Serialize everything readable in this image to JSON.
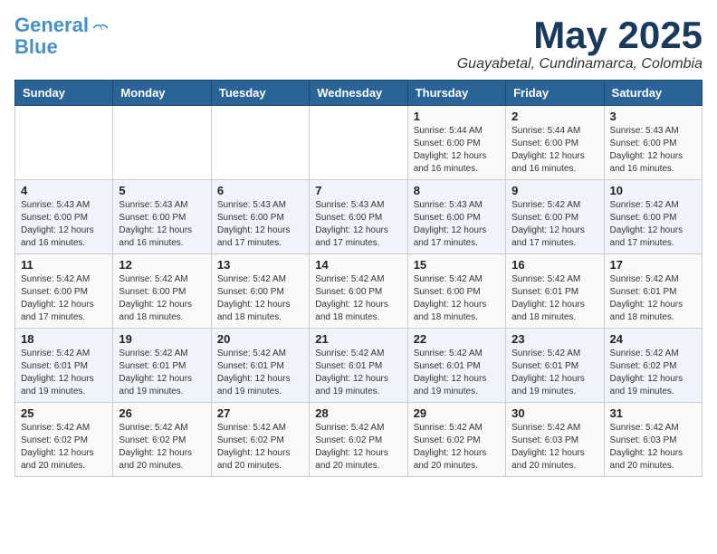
{
  "logo": {
    "line1": "General",
    "line2": "Blue"
  },
  "title": "May 2025",
  "location": "Guayabetal, Cundinamarca, Colombia",
  "weekdays": [
    "Sunday",
    "Monday",
    "Tuesday",
    "Wednesday",
    "Thursday",
    "Friday",
    "Saturday"
  ],
  "weeks": [
    [
      {
        "day": "",
        "info": ""
      },
      {
        "day": "",
        "info": ""
      },
      {
        "day": "",
        "info": ""
      },
      {
        "day": "",
        "info": ""
      },
      {
        "day": "1",
        "info": "Sunrise: 5:44 AM\nSunset: 6:00 PM\nDaylight: 12 hours\nand 16 minutes."
      },
      {
        "day": "2",
        "info": "Sunrise: 5:44 AM\nSunset: 6:00 PM\nDaylight: 12 hours\nand 16 minutes."
      },
      {
        "day": "3",
        "info": "Sunrise: 5:43 AM\nSunset: 6:00 PM\nDaylight: 12 hours\nand 16 minutes."
      }
    ],
    [
      {
        "day": "4",
        "info": "Sunrise: 5:43 AM\nSunset: 6:00 PM\nDaylight: 12 hours\nand 16 minutes."
      },
      {
        "day": "5",
        "info": "Sunrise: 5:43 AM\nSunset: 6:00 PM\nDaylight: 12 hours\nand 16 minutes."
      },
      {
        "day": "6",
        "info": "Sunrise: 5:43 AM\nSunset: 6:00 PM\nDaylight: 12 hours\nand 17 minutes."
      },
      {
        "day": "7",
        "info": "Sunrise: 5:43 AM\nSunset: 6:00 PM\nDaylight: 12 hours\nand 17 minutes."
      },
      {
        "day": "8",
        "info": "Sunrise: 5:43 AM\nSunset: 6:00 PM\nDaylight: 12 hours\nand 17 minutes."
      },
      {
        "day": "9",
        "info": "Sunrise: 5:42 AM\nSunset: 6:00 PM\nDaylight: 12 hours\nand 17 minutes."
      },
      {
        "day": "10",
        "info": "Sunrise: 5:42 AM\nSunset: 6:00 PM\nDaylight: 12 hours\nand 17 minutes."
      }
    ],
    [
      {
        "day": "11",
        "info": "Sunrise: 5:42 AM\nSunset: 6:00 PM\nDaylight: 12 hours\nand 17 minutes."
      },
      {
        "day": "12",
        "info": "Sunrise: 5:42 AM\nSunset: 6:00 PM\nDaylight: 12 hours\nand 18 minutes."
      },
      {
        "day": "13",
        "info": "Sunrise: 5:42 AM\nSunset: 6:00 PM\nDaylight: 12 hours\nand 18 minutes."
      },
      {
        "day": "14",
        "info": "Sunrise: 5:42 AM\nSunset: 6:00 PM\nDaylight: 12 hours\nand 18 minutes."
      },
      {
        "day": "15",
        "info": "Sunrise: 5:42 AM\nSunset: 6:00 PM\nDaylight: 12 hours\nand 18 minutes."
      },
      {
        "day": "16",
        "info": "Sunrise: 5:42 AM\nSunset: 6:01 PM\nDaylight: 12 hours\nand 18 minutes."
      },
      {
        "day": "17",
        "info": "Sunrise: 5:42 AM\nSunset: 6:01 PM\nDaylight: 12 hours\nand 18 minutes."
      }
    ],
    [
      {
        "day": "18",
        "info": "Sunrise: 5:42 AM\nSunset: 6:01 PM\nDaylight: 12 hours\nand 19 minutes."
      },
      {
        "day": "19",
        "info": "Sunrise: 5:42 AM\nSunset: 6:01 PM\nDaylight: 12 hours\nand 19 minutes."
      },
      {
        "day": "20",
        "info": "Sunrise: 5:42 AM\nSunset: 6:01 PM\nDaylight: 12 hours\nand 19 minutes."
      },
      {
        "day": "21",
        "info": "Sunrise: 5:42 AM\nSunset: 6:01 PM\nDaylight: 12 hours\nand 19 minutes."
      },
      {
        "day": "22",
        "info": "Sunrise: 5:42 AM\nSunset: 6:01 PM\nDaylight: 12 hours\nand 19 minutes."
      },
      {
        "day": "23",
        "info": "Sunrise: 5:42 AM\nSunset: 6:01 PM\nDaylight: 12 hours\nand 19 minutes."
      },
      {
        "day": "24",
        "info": "Sunrise: 5:42 AM\nSunset: 6:02 PM\nDaylight: 12 hours\nand 19 minutes."
      }
    ],
    [
      {
        "day": "25",
        "info": "Sunrise: 5:42 AM\nSunset: 6:02 PM\nDaylight: 12 hours\nand 20 minutes."
      },
      {
        "day": "26",
        "info": "Sunrise: 5:42 AM\nSunset: 6:02 PM\nDaylight: 12 hours\nand 20 minutes."
      },
      {
        "day": "27",
        "info": "Sunrise: 5:42 AM\nSunset: 6:02 PM\nDaylight: 12 hours\nand 20 minutes."
      },
      {
        "day": "28",
        "info": "Sunrise: 5:42 AM\nSunset: 6:02 PM\nDaylight: 12 hours\nand 20 minutes."
      },
      {
        "day": "29",
        "info": "Sunrise: 5:42 AM\nSunset: 6:02 PM\nDaylight: 12 hours\nand 20 minutes."
      },
      {
        "day": "30",
        "info": "Sunrise: 5:42 AM\nSunset: 6:03 PM\nDaylight: 12 hours\nand 20 minutes."
      },
      {
        "day": "31",
        "info": "Sunrise: 5:42 AM\nSunset: 6:03 PM\nDaylight: 12 hours\nand 20 minutes."
      }
    ]
  ]
}
